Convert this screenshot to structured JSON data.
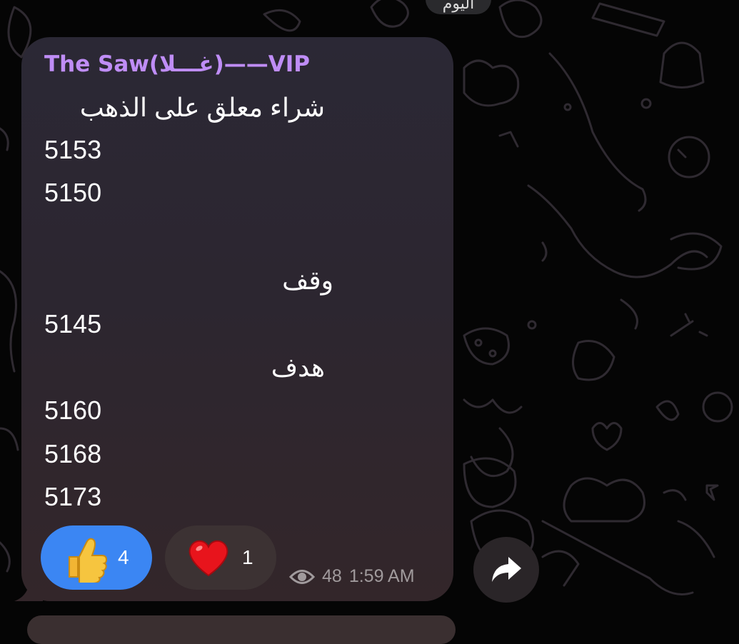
{
  "header": {
    "date_label": "اليوم"
  },
  "message": {
    "sender": "The Saw(غـــلا)——VIP",
    "lines": [
      "شراء معلق على الذهب",
      "5153",
      "5150",
      "وقف",
      "5145",
      "هدف",
      "5160",
      "5168",
      "5173"
    ],
    "reactions": [
      {
        "icon": "thumbs-up-icon",
        "count": "4",
        "color": "#3b86f3"
      },
      {
        "icon": "heart-icon",
        "count": "1",
        "color": "#3c3233"
      }
    ],
    "views": "48",
    "time": "1:59 AM"
  },
  "colors": {
    "sender": "#bf8df6",
    "background": "#050505",
    "bubble": "#2c2630"
  }
}
